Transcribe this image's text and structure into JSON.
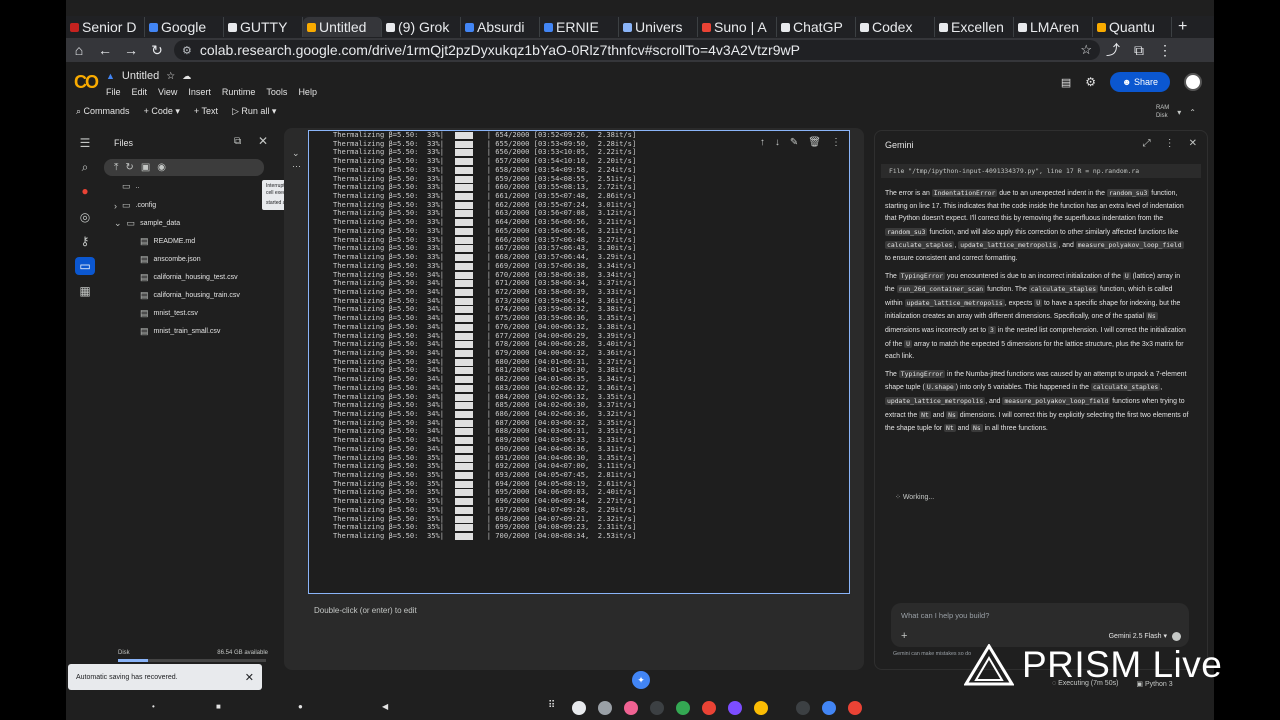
{
  "browser": {
    "tabs": [
      {
        "label": "Senior D",
        "color": "#c5221f"
      },
      {
        "label": "Google",
        "color": "#4285f4"
      },
      {
        "label": "GUTTY",
        "color": "#e8eaed"
      },
      {
        "label": "Untitled",
        "color": "#f9ab00",
        "active": true
      },
      {
        "label": "(9) Grok",
        "color": "#e8eaed"
      },
      {
        "label": "Absurdi",
        "color": "#4285f4"
      },
      {
        "label": "ERNIE",
        "color": "#4285f4"
      },
      {
        "label": "Univers",
        "color": "#8ab4f8"
      },
      {
        "label": "Suno | A",
        "color": "#ea4335"
      },
      {
        "label": "ChatGP",
        "color": "#e8eaed"
      },
      {
        "label": "Codex",
        "color": "#e8eaed"
      },
      {
        "label": "Excellen",
        "color": "#e8eaed"
      },
      {
        "label": "LMAren",
        "color": "#e8eaed"
      },
      {
        "label": "Quantu",
        "color": "#f9ab00"
      }
    ],
    "url": "colab.research.google.com/drive/1rmQjt2pzDyxukqz1bYaO-0Rlz7thnfcv#scrollTo=4v3A2Vtzr9wP"
  },
  "colab": {
    "title": "Untitled",
    "menu": [
      "File",
      "Edit",
      "View",
      "Insert",
      "Runtime",
      "Tools",
      "Help"
    ],
    "toolbar": {
      "commands": "Commands",
      "code": "+ Code",
      "text": "+ Text",
      "run_all": "Run all"
    },
    "share": "Share",
    "ram": "RAM",
    "disk": "Disk"
  },
  "files": {
    "title": "Files",
    "tree": [
      {
        "name": "..",
        "icon": "folder-icon"
      },
      {
        "name": ".config",
        "icon": "folder-icon"
      },
      {
        "name": "sample_data",
        "icon": "folder-icon"
      },
      {
        "name": "README.md",
        "icon": "file-icon"
      },
      {
        "name": "anscombe.json",
        "icon": "file-icon"
      },
      {
        "name": "california_housing_test.csv",
        "icon": "file-icon"
      },
      {
        "name": "california_housing_train.csv",
        "icon": "file-icon"
      },
      {
        "name": "mnist_test.csv",
        "icon": "file-icon"
      },
      {
        "name": "mnist_train_small.csv",
        "icon": "file-icon"
      }
    ],
    "tooltip": {
      "line1": "Interrupt execution (Ctrl+M I)",
      "line2": "cell executed since last change",
      "line3": "started at 12:24 AM (0 minutes ago)"
    },
    "disk_label": "Disk",
    "disk_available": "86.54 GB available",
    "toast": "Automatic saving has recovered."
  },
  "output": {
    "lines": [
      "Thermalizing β=5.50:  33%|          | 654/2000 [03:52<09:26,  2.38it/s]",
      "Thermalizing β=5.50:  33%|          | 655/2000 [03:53<09:50,  2.28it/s]",
      "Thermalizing β=5.50:  33%|          | 656/2000 [03:53<10:05,  2.22it/s]",
      "Thermalizing β=5.50:  33%|          | 657/2000 [03:54<10:10,  2.20it/s]",
      "Thermalizing β=5.50:  33%|          | 658/2000 [03:54<09:58,  2.24it/s]",
      "Thermalizing β=5.50:  33%|          | 659/2000 [03:54<08:55,  2.51it/s]",
      "Thermalizing β=5.50:  33%|          | 660/2000 [03:55<08:13,  2.72it/s]",
      "Thermalizing β=5.50:  33%|          | 661/2000 [03:55<07:48,  2.86it/s]",
      "Thermalizing β=5.50:  33%|          | 662/2000 [03:55<07:24,  3.01it/s]",
      "Thermalizing β=5.50:  33%|          | 663/2000 [03:56<07:08,  3.12it/s]",
      "Thermalizing β=5.50:  33%|          | 664/2000 [03:56<06:56,  3.21it/s]",
      "Thermalizing β=5.50:  33%|          | 665/2000 [03:56<06:56,  3.21it/s]",
      "Thermalizing β=5.50:  33%|          | 666/2000 [03:57<06:48,  3.27it/s]",
      "Thermalizing β=5.50:  33%|          | 667/2000 [03:57<06:43,  3.30it/s]",
      "Thermalizing β=5.50:  33%|          | 668/2000 [03:57<06:44,  3.29it/s]",
      "Thermalizing β=5.50:  33%|          | 669/2000 [03:57<06:38,  3.34it/s]",
      "Thermalizing β=5.50:  34%|          | 670/2000 [03:58<06:38,  3.34it/s]",
      "Thermalizing β=5.50:  34%|          | 671/2000 [03:58<06:34,  3.37it/s]",
      "Thermalizing β=5.50:  34%|          | 672/2000 [03:58<06:39,  3.33it/s]",
      "Thermalizing β=5.50:  34%|          | 673/2000 [03:59<06:34,  3.36it/s]",
      "Thermalizing β=5.50:  34%|          | 674/2000 [03:59<06:32,  3.38it/s]",
      "Thermalizing β=5.50:  34%|          | 675/2000 [03:59<06:36,  3.35it/s]",
      "Thermalizing β=5.50:  34%|          | 676/2000 [04:00<06:32,  3.38it/s]",
      "Thermalizing β=5.50:  34%|          | 677/2000 [04:00<06:29,  3.39it/s]",
      "Thermalizing β=5.50:  34%|          | 678/2000 [04:00<06:28,  3.40it/s]",
      "Thermalizing β=5.50:  34%|          | 679/2000 [04:00<06:32,  3.36it/s]",
      "Thermalizing β=5.50:  34%|          | 680/2000 [04:01<06:31,  3.37it/s]",
      "Thermalizing β=5.50:  34%|          | 681/2000 [04:01<06:30,  3.38it/s]",
      "Thermalizing β=5.50:  34%|          | 682/2000 [04:01<06:35,  3.34it/s]",
      "Thermalizing β=5.50:  34%|          | 683/2000 [04:02<06:32,  3.36it/s]",
      "Thermalizing β=5.50:  34%|          | 684/2000 [04:02<06:32,  3.35it/s]",
      "Thermalizing β=5.50:  34%|          | 685/2000 [04:02<06:30,  3.37it/s]",
      "Thermalizing β=5.50:  34%|          | 686/2000 [04:02<06:36,  3.32it/s]",
      "Thermalizing β=5.50:  34%|          | 687/2000 [04:03<06:32,  3.35it/s]",
      "Thermalizing β=5.50:  34%|          | 688/2000 [04:03<06:31,  3.35it/s]",
      "Thermalizing β=5.50:  34%|          | 689/2000 [04:03<06:33,  3.33it/s]",
      "Thermalizing β=5.50:  34%|          | 690/2000 [04:04<06:36,  3.31it/s]",
      "Thermalizing β=5.50:  35%|          | 691/2000 [04:04<06:30,  3.35it/s]",
      "Thermalizing β=5.50:  35%|          | 692/2000 [04:04<07:00,  3.11it/s]",
      "Thermalizing β=5.50:  35%|          | 693/2000 [04:05<07:45,  2.81it/s]",
      "Thermalizing β=5.50:  35%|          | 694/2000 [04:05<08:19,  2.61it/s]",
      "Thermalizing β=5.50:  35%|          | 695/2000 [04:06<09:03,  2.40it/s]",
      "Thermalizing β=5.50:  35%|          | 696/2000 [04:06<09:34,  2.27it/s]",
      "Thermalizing β=5.50:  35%|          | 697/2000 [04:07<09:28,  2.29it/s]",
      "Thermalizing β=5.50:  35%|          | 698/2000 [04:07<09:21,  2.32it/s]",
      "Thermalizing β=5.50:  35%|          | 699/2000 [04:08<09:23,  2.31it/s]",
      "Thermalizing β=5.50:  35%|          | 700/2000 [04:08<08:34,  2.53it/s]"
    ],
    "edit_hint": "Double-click (or enter) to edit"
  },
  "gemini": {
    "title": "Gemini",
    "file_line": "File \"/tmp/ipython-input-4091334379.py\", line 17 R = np.random.ra",
    "para1": {
      "t1": "The error is an ",
      "c1": "IndentationError",
      "t2": " due to an unexpected indent in the ",
      "c2": "random_su3",
      "t3": " function, starting on line 17. This indicates that the code inside the function has an extra level of indentation that Python doesn't expect. I'll correct this by removing the superfluous indentation from the ",
      "c3": "random_su3",
      "t4": " function, and will also apply this correction to other similarly affected functions like ",
      "c4": "calculate_staples",
      "t5": ", ",
      "c5": "update_lattice_metropolis",
      "t6": ", and ",
      "c6": "measure_polyakov_loop_field",
      "t7": " to ensure consistent and correct formatting."
    },
    "para2": {
      "t1": "The ",
      "c1": "TypingError",
      "t2": " you encountered is due to an incorrect initialization of the ",
      "c2": "U",
      "t3": " (lattice) array in the ",
      "c3": "run_26d_container_scan",
      "t4": " function. The ",
      "c4": "calculate_staples",
      "t5": " function, which is called within ",
      "c5": "update_lattice_metropolis",
      "t6": ", expects ",
      "c6": "U",
      "t7": " to have a specific shape for indexing, but the initialization creates an array with different dimensions. Specifically, one of the spatial ",
      "c7": "Ns",
      "t8": " dimensions was incorrectly set to ",
      "c8": "3",
      "t9": " in the nested list comprehension. I will correct the initialization of the ",
      "c9": "U",
      "t10": " array to match the expected 5 dimensions for the lattice structure, plus the 3x3 matrix for each link."
    },
    "para3": {
      "t1": "The ",
      "c1": "TypingError",
      "t2": " in the Numba-jitted functions was caused by an attempt to unpack a 7-element shape tuple (",
      "c2": "U.shape",
      "t3": ") into only 5 variables. This happened in the ",
      "c3": "calculate_staples",
      "t4": ", ",
      "c4": "update_lattice_metropolis",
      "t5": ", and ",
      "c5": "measure_polyakov_loop_field",
      "t6": " functions when trying to extract the ",
      "c6": "Nt",
      "t7": " and ",
      "c7": "Ns",
      "t8": " dimensions. I will correct this by explicitly selecting the first two elements of the shape tuple for ",
      "c8": "Nt",
      "t9": " and ",
      "c9": "Ns",
      "t10": " in all three functions."
    },
    "working": "Working...",
    "prompt_placeholder": "What can I help you build?",
    "model": "Gemini 2.5 Flash",
    "disclaimer": "Gemini can make mistakes so do"
  },
  "status": {
    "executing": "Executing (7m 50s)",
    "runtime": "Python 3"
  },
  "overlay": {
    "prism": "PRISM Live"
  },
  "colors": {
    "accent": "#0b57d0",
    "cell_border": "#8ab4f8",
    "logo": "#f9ab00"
  }
}
